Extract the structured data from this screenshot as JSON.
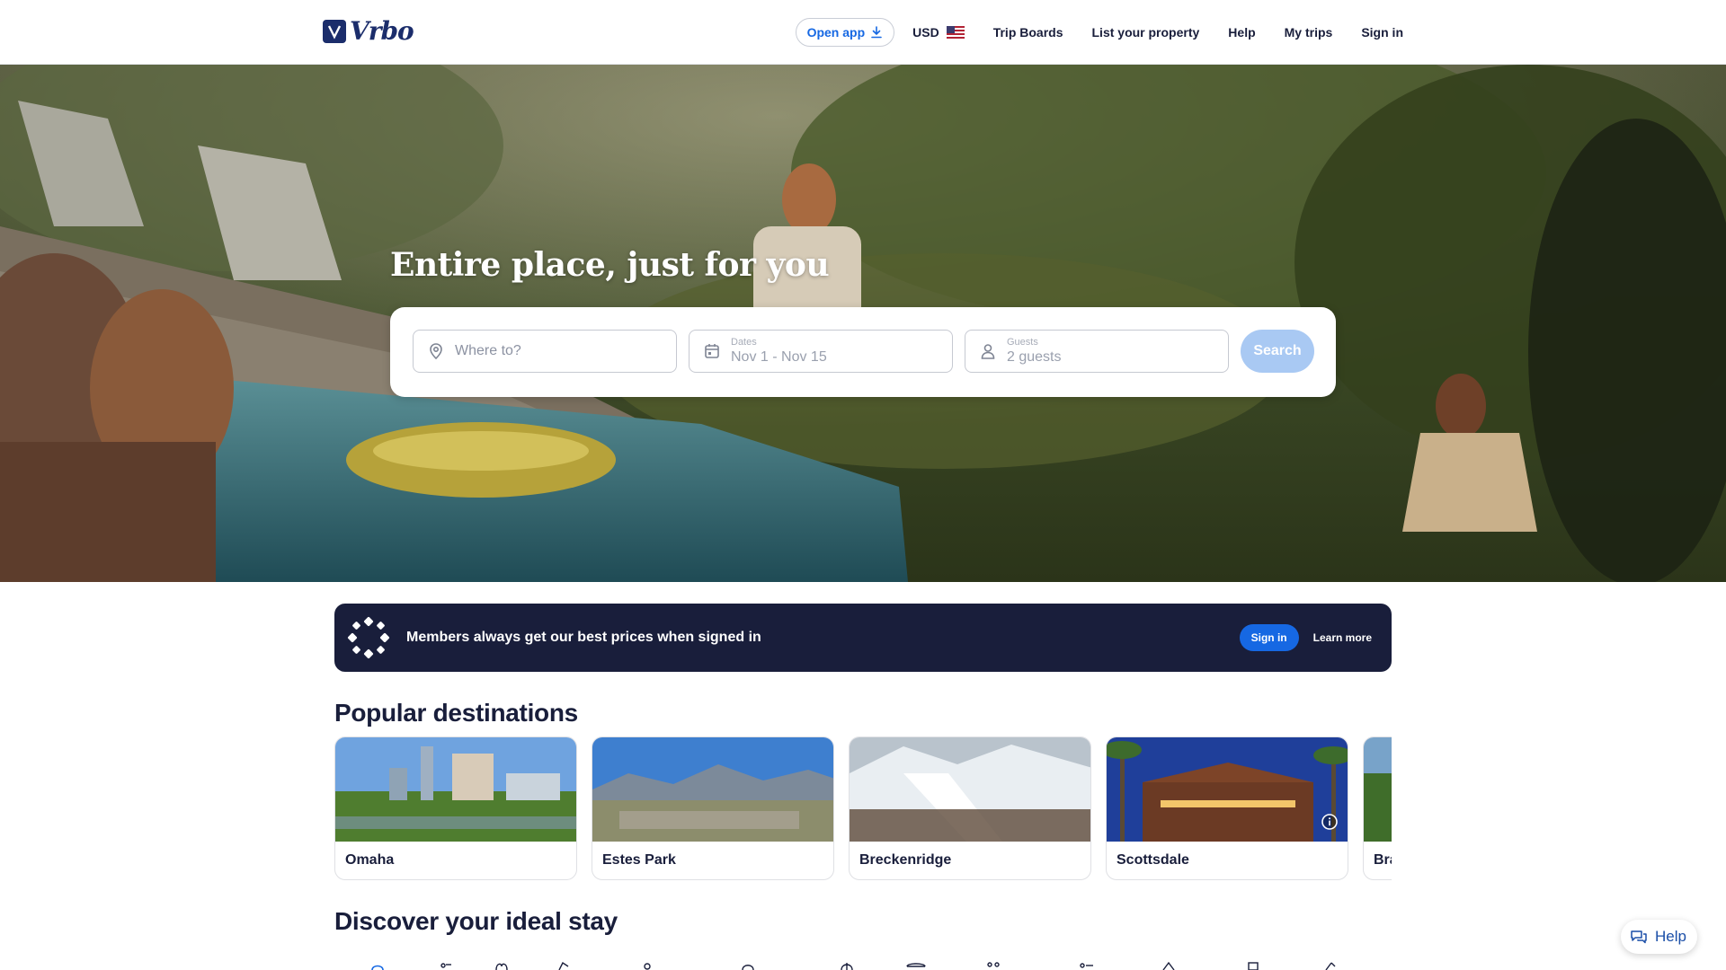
{
  "header": {
    "logo_text": "Vrbo",
    "open_app_label": "Open app",
    "currency_label": "USD",
    "nav": {
      "trip_boards": "Trip Boards",
      "list_property": "List your property",
      "help": "Help",
      "my_trips": "My trips",
      "sign_in": "Sign in"
    }
  },
  "hero": {
    "title": "Entire place, just for you",
    "search": {
      "destination_placeholder": "Where to?",
      "dates_label": "Dates",
      "dates_value": "Nov 1 - Nov 15",
      "guests_label": "Guests",
      "guests_value": "2 guests",
      "search_label": "Search"
    }
  },
  "member_banner": {
    "text": "Members always get our best prices when signed in",
    "sign_in_label": "Sign in",
    "learn_more_label": "Learn more"
  },
  "popular": {
    "title": "Popular destinations",
    "destinations": [
      {
        "name": "Omaha"
      },
      {
        "name": "Estes Park"
      },
      {
        "name": "Breckenridge"
      },
      {
        "name": "Scottsdale"
      },
      {
        "name": "Bra"
      }
    ]
  },
  "discover": {
    "title": "Discover your ideal stay"
  },
  "help_fab": {
    "label": "Help"
  },
  "colors": {
    "brand_navy": "#191e3b",
    "accent_blue": "#1668e3",
    "search_disabled": "#a9c9f3"
  },
  "icons": [
    "download-icon",
    "us-flag-icon",
    "location-pin-icon",
    "calendar-icon",
    "person-icon",
    "member-flower-icon",
    "info-icon",
    "chat-icon"
  ]
}
